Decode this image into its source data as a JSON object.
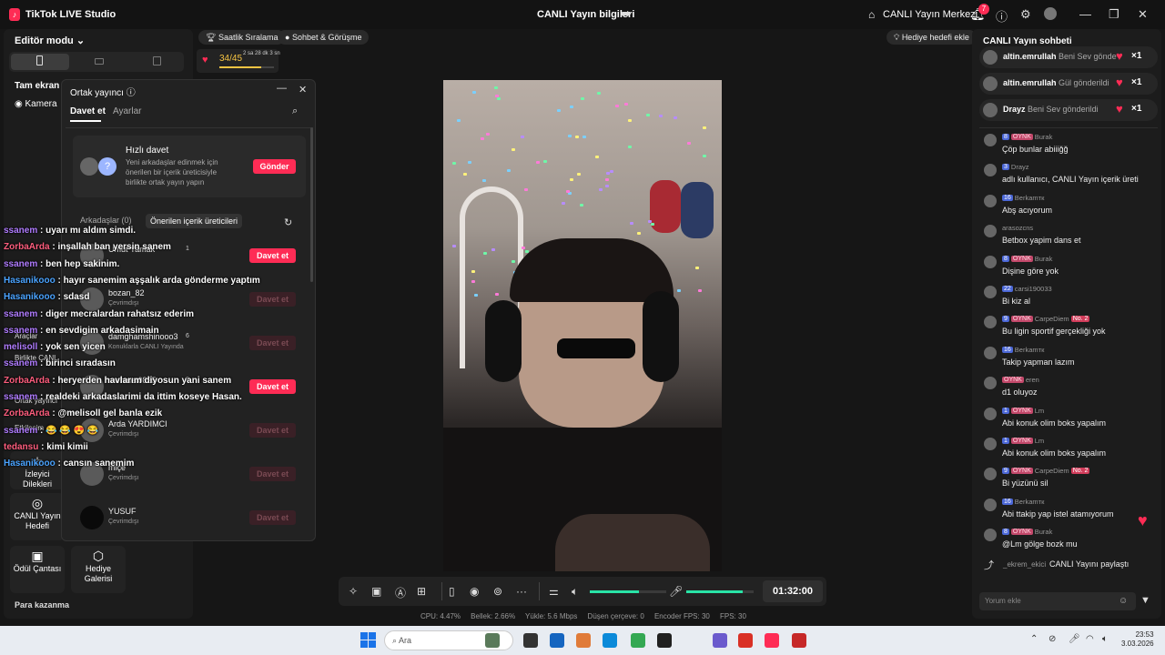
{
  "titlebar": {
    "app_name": "TikTok LIVE Studio",
    "center_title": "CANLI Yayın bilgileri",
    "live_center": "CANLI Yayın Merkezi",
    "notification_count": "7"
  },
  "left": {
    "editor_mode": "Editör modu",
    "fullscreen": "Tam ekran k",
    "camera": "Kamera",
    "tools": [
      {
        "label": "Araçlar",
        "icon": "tools-icon"
      },
      {
        "label": "Birlikte CANL",
        "icon": "multi-guest-icon"
      },
      {
        "label": "Ortak yayıncı",
        "icon": "co-host-icon"
      },
      {
        "label": "Etkileşim",
        "icon": "interaction-icon"
      },
      {
        "label": "İzleyici Dilekleri",
        "icon": "wishes-icon"
      },
      {
        "label": "CANLI Yayın Hedefi",
        "icon": "target-icon"
      },
      {
        "label": "Ödül Çantası",
        "icon": "bag-icon"
      },
      {
        "label": "Hediye Galerisi",
        "icon": "gift-gallery-icon"
      }
    ],
    "para": "Para kazanma"
  },
  "top_pills": {
    "hourly": "Saatlik Sıralama",
    "chat_meet": "Sohbet & Görüşme",
    "gift_goal": "Hediye hedefi ekle"
  },
  "goal": {
    "count": "34/45",
    "time": "2 sa 28 dk 3 sn",
    "progress": 0.76
  },
  "ortak": {
    "title": "Ortak yayıncı",
    "tab_invite": "Davet et",
    "tab_settings": "Ayarlar",
    "quick_title": "Hızlı davet",
    "quick_desc": "Yeni arkadaşlar edinmek için önerilen bir içerik üreticisiyle birlikte ortak yayın yapın",
    "send": "Gönder",
    "friends_tab": "Arkadaşlar (0)",
    "suggested_tab": "Önerilen içerik üreticileri",
    "creators": [
      {
        "name": "Umut Yamak",
        "sub": "",
        "count": "1",
        "button": "Davet et",
        "active": true
      },
      {
        "name": "bozan_82",
        "sub": "Çevrimdışı",
        "count": "",
        "button": "Davet et",
        "active": false
      },
      {
        "name": "damghamshinooo3",
        "sub": "Konuklarla CANLI Yayında",
        "count": "6",
        "button": "Davet et",
        "active": false
      },
      {
        "name": "mehmet0825",
        "sub": "",
        "count": "2",
        "button": "Davet et",
        "active": true
      },
      {
        "name": "Arda YARDIMCI",
        "sub": "Çevrimdışı",
        "count": "",
        "button": "Davet et",
        "active": false
      },
      {
        "name": "miçe",
        "sub": "Çevrimdışı",
        "count": "",
        "button": "Davet et",
        "active": false
      },
      {
        "name": "YUSUF",
        "sub": "Çevrimdışı",
        "count": "",
        "button": "Davet et",
        "active": false
      }
    ]
  },
  "overlay_chat": [
    {
      "user": "ssanem",
      "text": ": uyarı mı aldım simdi.",
      "color": "#b07cff"
    },
    {
      "user": "ZorbaArda",
      "text": ": inşallah ban yersin sanem",
      "color": "#ff5e7e"
    },
    {
      "user": "ssanem",
      "text": ": ben hep sakinim.",
      "color": "#b07cff"
    },
    {
      "user": "Hasanikooo",
      "text": ": hayır sanemim aşşalık arda gönderme yaptım",
      "color": "#4aa3ff"
    },
    {
      "user": "Hasanikooo",
      "text": ": sdasd",
      "color": "#4aa3ff"
    },
    {
      "user": "ssanem",
      "text": ": diger mecralardan rahatsız ederim",
      "color": "#b07cff"
    },
    {
      "user": "ssanem",
      "text": ": en sevdigim arkadasimain",
      "color": "#b07cff"
    },
    {
      "user": "melisoll",
      "text": ": yok sen yicen",
      "color": "#b07cff"
    },
    {
      "user": "ssanem",
      "text": ": birinci sıradasın",
      "color": "#b07cff"
    },
    {
      "user": "ZorbaArda",
      "text": ": heryerden havlarım diyosun yani sanem",
      "color": "#ff5e7e"
    },
    {
      "user": "ssanem",
      "text": ": realdeki arkadaslarimi da ittim koseye Hasan.",
      "color": "#b07cff"
    },
    {
      "user": "ZorbaArda",
      "text": ": @melisoll gel banla ezik",
      "color": "#ff5e7e"
    },
    {
      "user": "ssanem",
      "text": ": 😂 😂 😍 😂",
      "color": "#b07cff"
    },
    {
      "user": "tedansu",
      "text": ": kimi kimii",
      "color": "#ff5e7e"
    },
    {
      "user": "Hasanikooo",
      "text": ": cansın sanemim",
      "color": "#4aa3ff"
    }
  ],
  "right": {
    "title": "CANLI Yayın sohbeti",
    "gifts": [
      {
        "user": "altin.emrullah",
        "text": "Beni Sev gönde",
        "mult": "×1"
      },
      {
        "user": "altin.emrullah",
        "text": "Gül gönderildi",
        "mult": "×1"
      },
      {
        "user": "Drayz",
        "text": "Beni Sev gönderildi",
        "mult": "×1"
      }
    ],
    "comments": [
      {
        "lvl": "8",
        "oy": "OYNK",
        "user": "Burak",
        "no": "",
        "msg": "Çöp bunlar abiiiğğ"
      },
      {
        "lvl": "3",
        "oy": "",
        "user": "Drayz",
        "no": "",
        "msg": "adlı kullanıcı, CANLI Yayın içerik üreticisini takip etti"
      },
      {
        "lvl": "16",
        "oy": "",
        "user": "Berkamтк",
        "no": "",
        "msg": "Abş acıyorum"
      },
      {
        "lvl": "",
        "oy": "",
        "user": "arasozcns",
        "no": "",
        "msg": "Betbox yapim dans et"
      },
      {
        "lvl": "8",
        "oy": "OYNK",
        "user": "Burak",
        "no": "",
        "msg": "Dişine göre yok"
      },
      {
        "lvl": "22",
        "oy": "",
        "user": "carsi190033",
        "no": "",
        "msg": "Bi kiz al"
      },
      {
        "lvl": "9",
        "oy": "OYNK",
        "user": "CarpeDiem",
        "no": "No. 2",
        "msg": "Bu ligin sportif gerçekliği yok"
      },
      {
        "lvl": "16",
        "oy": "",
        "user": "Berkamтк",
        "no": "",
        "msg": "Takip yapman lazım"
      },
      {
        "lvl": "",
        "oy": "OYNK",
        "user": "eren",
        "no": "",
        "msg": "d1 oluyoz"
      },
      {
        "lvl": "1",
        "oy": "OYNK",
        "user": "Lm",
        "no": "",
        "msg": "Abi konuk olim boks yapalım"
      },
      {
        "lvl": "1",
        "oy": "OYNK",
        "user": "Lm",
        "no": "",
        "msg": "Abi konuk olim boks yapalım"
      },
      {
        "lvl": "9",
        "oy": "OYNK",
        "user": "CarpeDiem",
        "no": "No. 2",
        "msg": "Bi yüzünü sil"
      },
      {
        "lvl": "16",
        "oy": "",
        "user": "Berkamтк",
        "no": "",
        "msg": "Abi ttakip yap istel atamıyorum"
      },
      {
        "lvl": "8",
        "oy": "OYNK",
        "user": "Burak",
        "no": "",
        "msg": "@Lm gölge bozk mu"
      }
    ],
    "share_user": "_ekrem_ekici",
    "share_text": "CANLI Yayını paylaştı",
    "comment_placeholder": "Yorum ekle"
  },
  "controls": {
    "timer": "01:32:00",
    "volume_speaker": 0.64,
    "volume_mic": 0.84
  },
  "stats": {
    "cpu": "CPU:  4.47%",
    "memory": "Bellek:  2.66%",
    "upload": "Yükle:  5.6 Mbps",
    "dropped": "Düşen çerçeve:  0",
    "encoder": "Encoder FPS:  30",
    "fps": "FPS:  30"
  },
  "taskbar": {
    "search": "Ara",
    "time": "23:53",
    "date": "3.03.2026"
  }
}
